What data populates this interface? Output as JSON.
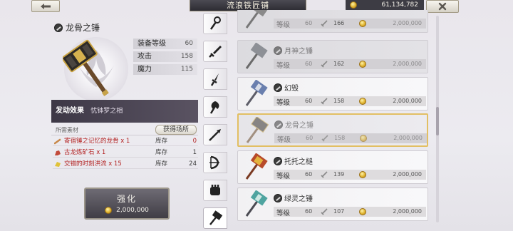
{
  "header": {
    "title": "流浪铁匠铺",
    "gold": "61,134,782"
  },
  "selected_item": {
    "name": "龙骨之锤",
    "stats": [
      {
        "label": "装备等级",
        "value": "60"
      },
      {
        "label": "攻击",
        "value": "158"
      },
      {
        "label": "魔力",
        "value": "115"
      }
    ],
    "effect_label": "发动效果",
    "effect_value": "忧钵罗之相",
    "materials_header": "所需素材",
    "source_button": "获得场所",
    "materials": [
      {
        "name": "寄宿锤之记忆的龙骨 x 1",
        "stock_label": "库存",
        "stock": "0",
        "insufficient": true
      },
      {
        "name": "古龙炼矿石 x 1",
        "stock_label": "库存",
        "stock": "1",
        "insufficient": true
      },
      {
        "name": "交错的时刻洪流 x 15",
        "stock_label": "库存",
        "stock": "24",
        "insufficient": false
      }
    ],
    "enhance_label": "强化",
    "enhance_cost": "2,000,000"
  },
  "tabs": [
    "staff-icon",
    "sword-icon",
    "dagger-icon",
    "axe-icon",
    "spear-icon",
    "bow-icon",
    "fist-icon",
    "hammer-icon"
  ],
  "weapons": [
    {
      "name": "",
      "level_label": "等级",
      "level": "60",
      "atk": "166",
      "price": "2,000,000",
      "state": "dim"
    },
    {
      "name": "月神之锤",
      "level_label": "等级",
      "level": "60",
      "atk": "162",
      "price": "2,000,000",
      "state": "dim"
    },
    {
      "name": "幻毁",
      "level_label": "等级",
      "level": "60",
      "atk": "158",
      "price": "2,000,000",
      "state": "normal"
    },
    {
      "name": "龙骨之锤",
      "level_label": "等级",
      "level": "60",
      "atk": "158",
      "price": "2,000,000",
      "state": "selected"
    },
    {
      "name": "托托之槌",
      "level_label": "等级",
      "level": "60",
      "atk": "139",
      "price": "2,000,000",
      "state": "normal"
    },
    {
      "name": "绿灵之锤",
      "level_label": "等级",
      "level": "60",
      "atk": "107",
      "price": "2,000,000",
      "state": "normal"
    }
  ],
  "colors": {
    "accent_gold": "#e2bf63",
    "insufficient_red": "#b32222",
    "effect_bar": "#3d3846"
  }
}
